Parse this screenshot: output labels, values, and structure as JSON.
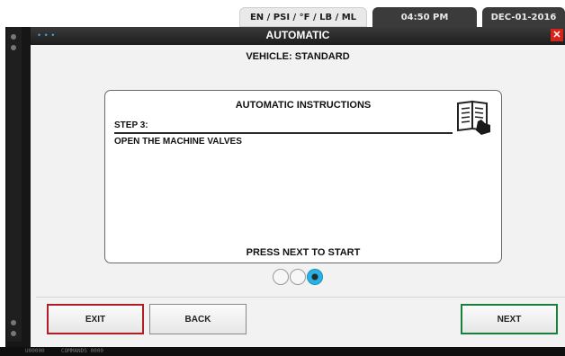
{
  "header_tabs": {
    "units": "EN / PSI / °F / LB / ML",
    "time": "04:50 PM",
    "date": "DEC-01-2016"
  },
  "window": {
    "title": "AUTOMATIC",
    "title_dots": "• • •",
    "close_glyph": "✕"
  },
  "vehicle": {
    "label": "VEHICLE: STANDARD"
  },
  "instructions": {
    "title": "AUTOMATIC INSTRUCTIONS",
    "step_label": "STEP 3:",
    "step_text": "OPEN THE MACHINE VALVES",
    "prompt": "PRESS NEXT TO START",
    "icon": "book-hand-icon"
  },
  "pager": {
    "total": 3,
    "current": 3
  },
  "buttons": {
    "exit": "EXIT",
    "back": "BACK",
    "next": "NEXT"
  },
  "status_bar": {
    "left": "U00000",
    "right": "COMMANDS 0000"
  },
  "colors": {
    "title_bar": "#1d1d1d",
    "accent_blue": "#27b3e6",
    "exit_border": "#b11e23",
    "next_border": "#1a7f3a"
  }
}
